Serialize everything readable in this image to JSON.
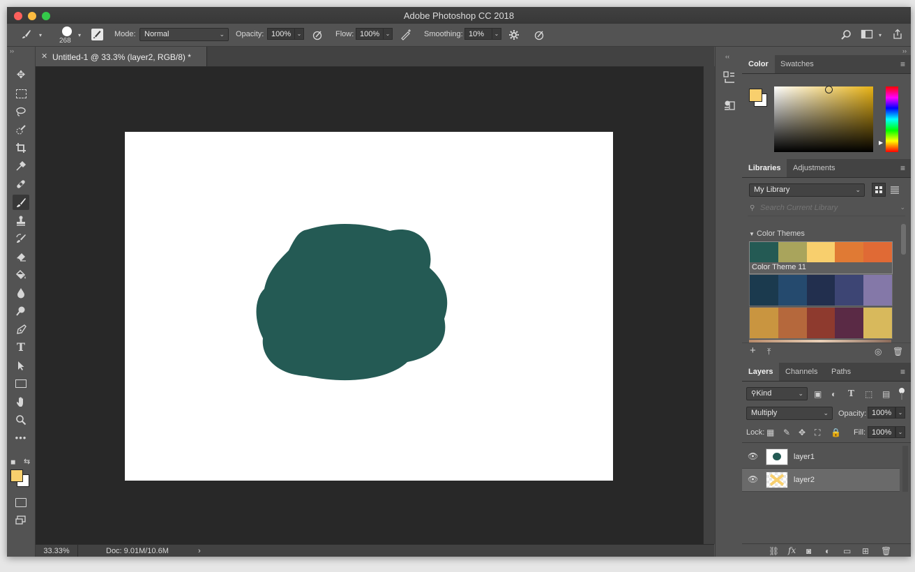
{
  "app": {
    "title": "Adobe Photoshop CC 2018"
  },
  "options": {
    "brush_size": "268",
    "mode_label": "Mode:",
    "mode_value": "Normal",
    "opacity_label": "Opacity:",
    "opacity_value": "100%",
    "flow_label": "Flow:",
    "flow_value": "100%",
    "smoothing_label": "Smoothing:",
    "smoothing_value": "10%"
  },
  "document": {
    "tab_title": "Untitled-1 @ 33.3% (layer2, RGB/8) *",
    "zoom": "33.33%",
    "doc_size": "Doc: 9.01M/10.6M",
    "status_arrow": "›"
  },
  "colors": {
    "foreground": "#f8cf6d",
    "background": "#ffffff",
    "shape_fill": "#245a54",
    "panel_dark": "#535353"
  },
  "color_panel": {
    "tabs": [
      "Color",
      "Swatches"
    ]
  },
  "libraries_panel": {
    "tabs": [
      "Libraries",
      "Adjustments"
    ],
    "library_name": "My Library",
    "search_placeholder": "Search Current Library",
    "section_label": "Color Themes",
    "themes": [
      {
        "label": "Color Theme 11",
        "colors": [
          "#245a54",
          "#a9a45c",
          "#f8cf6d",
          "#e07a34",
          "#e06a35"
        ]
      },
      {
        "label": "",
        "colors": [
          "#1b3a4e",
          "#254a6e",
          "#222f4e",
          "#3d4574",
          "#8478a8"
        ]
      },
      {
        "label": "",
        "colors": [
          "#c99540",
          "#b5683c",
          "#8e3a2e",
          "#5a2a45",
          "#d8b95c"
        ]
      }
    ]
  },
  "layers_panel": {
    "tabs": [
      "Layers",
      "Channels",
      "Paths"
    ],
    "filter_kind": "Kind",
    "blend_mode": "Multiply",
    "opacity_label": "Opacity:",
    "opacity_value": "100%",
    "lock_label": "Lock:",
    "fill_label": "Fill:",
    "fill_value": "100%",
    "layers": [
      {
        "name": "layer1",
        "selected": false
      },
      {
        "name": "layer2",
        "selected": true
      }
    ]
  }
}
